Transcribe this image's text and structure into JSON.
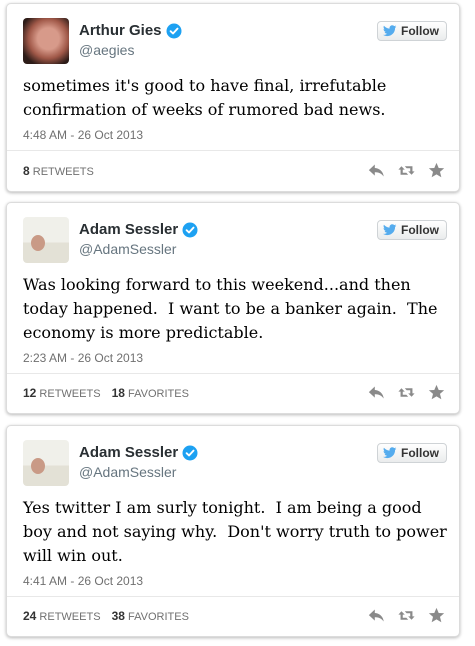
{
  "follow_label": "Follow",
  "colors": {
    "verified": "#1da1f2",
    "bird": "#55acee",
    "action_icons": "#8a8a8a"
  },
  "tweets": [
    {
      "display_name": "Arthur Gies",
      "screen_name": "@aegies",
      "text": "sometimes it's good to have final, irrefutable\nconfirmation of weeks of rumored bad news.",
      "timestamp": "4:48 AM - 26 Oct 2013",
      "retweets_count": "8",
      "retweets_label": "RETWEETS",
      "favorites_count": "",
      "favorites_label": ""
    },
    {
      "display_name": "Adam Sessler",
      "screen_name": "@AdamSessler",
      "text": "Was looking forward to this weekend...and then\ntoday happened.  I want to be a banker again.  The\neconomy is more predictable.",
      "timestamp": "2:23 AM - 26 Oct 2013",
      "retweets_count": "12",
      "retweets_label": "RETWEETS",
      "favorites_count": "18",
      "favorites_label": "FAVORITES"
    },
    {
      "display_name": "Adam Sessler",
      "screen_name": "@AdamSessler",
      "text": "Yes twitter I am surly tonight.  I am being a good\nboy and not saying why.  Don't worry truth to power\nwill win out.",
      "timestamp": "4:41 AM - 26 Oct 2013",
      "retweets_count": "24",
      "retweets_label": "RETWEETS",
      "favorites_count": "38",
      "favorites_label": "FAVORITES"
    }
  ],
  "icons": {
    "verified": "verified-badge-icon",
    "bird": "twitter-bird-icon",
    "reply": "reply-icon",
    "retweet": "retweet-icon",
    "favorite": "star-icon"
  }
}
